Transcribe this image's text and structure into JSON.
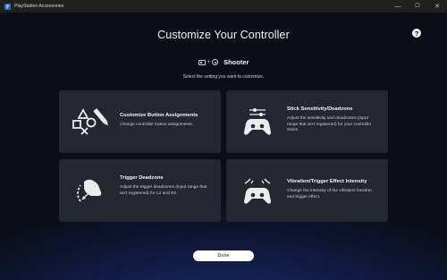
{
  "window": {
    "app_title": "PlayStation Accessories",
    "controls": {
      "minimize": "—",
      "maximize": "☐",
      "close": "✕"
    }
  },
  "header": {
    "title": "Customize Your Controller",
    "help": "?"
  },
  "profile": {
    "plus": "+",
    "name": "Shooter"
  },
  "instruction": "Select the setting you want to customize.",
  "cards": [
    {
      "title": "Customize Button Assignments",
      "description": "Change controller button assignments.",
      "icon": "buttons-pencil-icon"
    },
    {
      "title": "Stick Sensitivity/Deadzone",
      "description": "Adjust the sensitivity and deadzones (input range that isn't registered) for your controller sticks.",
      "icon": "controller-sticks-icon"
    },
    {
      "title": "Trigger Deadzone",
      "description_before": "Adjust the trigger deadzones (input range that isn't registered) for",
      "description_and": "and",
      "description_end": ".",
      "trigger_left": "L2",
      "trigger_right": "R2",
      "icon": "trigger-icon"
    },
    {
      "title": "Vibration/Trigger Effect Intensity",
      "description": "Change the intensity of the vibration function and trigger effect.",
      "icon": "controller-vibration-icon"
    }
  ],
  "done_label": "Done",
  "colors": {
    "background": "#0b0d17",
    "card": "#252730",
    "accent_glow": "#1c2f72",
    "button": "#ffffff"
  }
}
